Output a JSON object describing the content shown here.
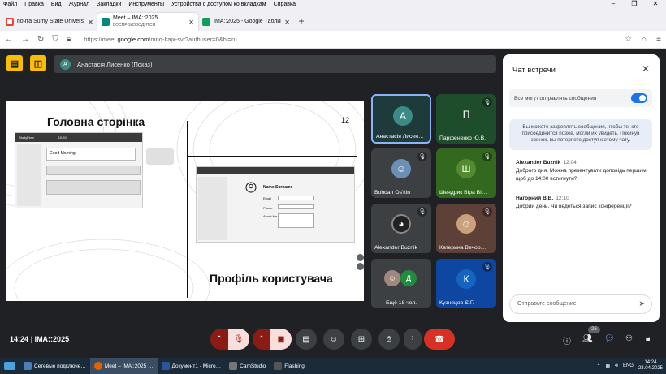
{
  "menu": [
    "Файл",
    "Правка",
    "Вид",
    "Журнал",
    "Закладки",
    "Инструменты",
    "Устройства с доступом ко вкладкам",
    "Справка"
  ],
  "tabs": [
    {
      "label": "почта Sumy State University",
      "color": "#ea4335"
    },
    {
      "label": "Meet – IMA::2025",
      "sub": "ВОСПРОИЗВОДИТСЯ",
      "color": "#00897b"
    },
    {
      "label": "IMA::2025 - Google Таблицы",
      "color": "#0f9d58"
    }
  ],
  "url": {
    "prefix": "https://meet.",
    "host": "google.com",
    "path": "/mnq-kajx-svf?authuser=0&hl=ru"
  },
  "presenter": {
    "initial": "А",
    "name": "Анастасія Лисенко (Показ)"
  },
  "slide": {
    "title_home": "Головна сторінка",
    "title_profile": "Профіль користувача",
    "page_num": "12",
    "mock_app": "StudyFlow",
    "mock_time": "10:20",
    "greeting": "Good Morning!",
    "profile_name": "Name Surname",
    "profile_fields": [
      "Email",
      "Phone",
      "About Me"
    ]
  },
  "participants": [
    {
      "name": "Анастасія Лисен…",
      "initial": "А",
      "bg": "#1e3a3a",
      "avatar": "#3d8b86",
      "muted": false,
      "speaking": true
    },
    {
      "name": "Парфененко Ю.В.",
      "initial": "П",
      "bg": "#1e4d2b",
      "avatar": "#1e4d2b",
      "muted": true
    },
    {
      "name": "Bohdan Os'kin",
      "initial": "",
      "bg": "#3c4043",
      "avatar": "#6b8fb5",
      "muted": true
    },
    {
      "name": "Шендрик Віра Ві…",
      "initial": "Ш",
      "bg": "#33691e",
      "avatar": "#558b2f",
      "muted": true
    },
    {
      "name": "Alexander Buznik",
      "initial": "",
      "bg": "#3c4043",
      "avatar": "#333",
      "muted": true
    },
    {
      "name": "Катерина Вечор…",
      "initial": "",
      "bg": "#5d4037",
      "avatar": "#c9a27d",
      "muted": true
    },
    {
      "name": "Ещё 18 чел.",
      "initial": "Д",
      "bg": "#3c4043",
      "avatar": "#1e8e3e",
      "muted": false
    },
    {
      "name": "Кузнецов Є.Г.",
      "initial": "К",
      "bg": "#0d47a1",
      "avatar": "#1565c0",
      "muted": true
    }
  ],
  "chat": {
    "title": "Чат встречи",
    "allow_label": "Все могут отправлять сообщения",
    "info": "Вы можете закреплять сообщения, чтобы те, кто присоединится позже, могли их увидеть. Покинув звонок, вы потеряете доступ к этому чату.",
    "messages": [
      {
        "author": "Alexander Buznik",
        "time": "12:04",
        "text": "Доброго дня. Можна презентувати доповідь першим, щоб до 14:00 встигнути?"
      },
      {
        "author": "Нагорний В.В.",
        "time": "12:10",
        "text": "Добрий день. Чи ведеться запис конференції?"
      }
    ],
    "input_placeholder": "Отправьте сообщение"
  },
  "bottom": {
    "time": "14:24",
    "meeting": "IMA::2025",
    "people_count": "26"
  },
  "taskbar": {
    "items": [
      {
        "label": "Сетевые подключе…",
        "color": "#4a7fb5"
      },
      {
        "label": "Meet – IMA::2025 …",
        "color": "#e66000"
      },
      {
        "label": "Документ1 - Micro…",
        "color": "#2b579a"
      },
      {
        "label": "CamStudio",
        "color": "#777"
      },
      {
        "label": "Flashing",
        "color": "#555"
      }
    ],
    "lang": "ENG",
    "time": "14:24",
    "date": "23.04.2025"
  }
}
